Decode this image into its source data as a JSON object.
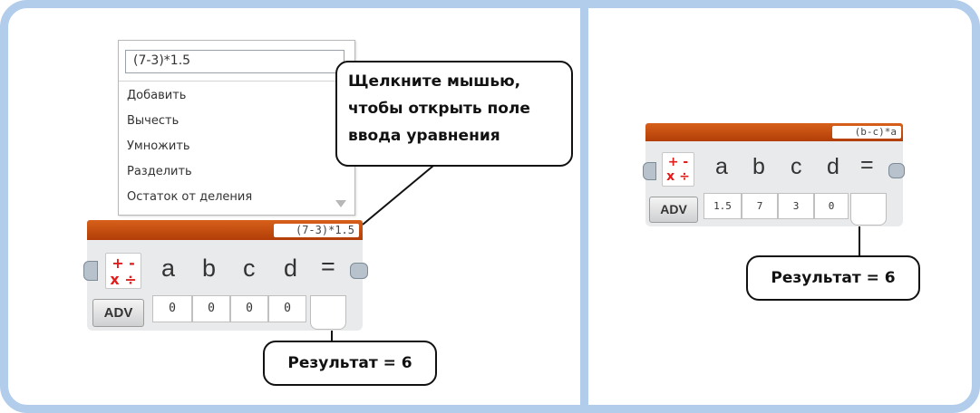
{
  "dropdown": {
    "input_value": "(7-3)*1.5",
    "items": [
      "Добавить",
      "Вычесть",
      "Умножить",
      "Разделить",
      "Остаток от деления"
    ]
  },
  "callout_main": "Щелкните мышью, чтобы открыть поле ввода уравнения",
  "left_block": {
    "equation": "(7-3)*1.5",
    "op_top": "+ -",
    "op_bottom": "x ÷",
    "params": [
      "a",
      "b",
      "c",
      "d",
      "="
    ],
    "adv_label": "ADV",
    "values": [
      "0",
      "0",
      "0",
      "0"
    ]
  },
  "right_block": {
    "equation": "(b-c)*a",
    "op_top": "+ -",
    "op_bottom": "x ÷",
    "params": [
      "a",
      "b",
      "c",
      "d",
      "="
    ],
    "adv_label": "ADV",
    "values": [
      "1.5",
      "7",
      "3",
      "0"
    ]
  },
  "result_left": "Результат = 6",
  "result_right": "Результат = 6",
  "colors": {
    "frame": "#b2ccec",
    "block_bar": "#c84e10",
    "operator": "#e21b1b"
  }
}
